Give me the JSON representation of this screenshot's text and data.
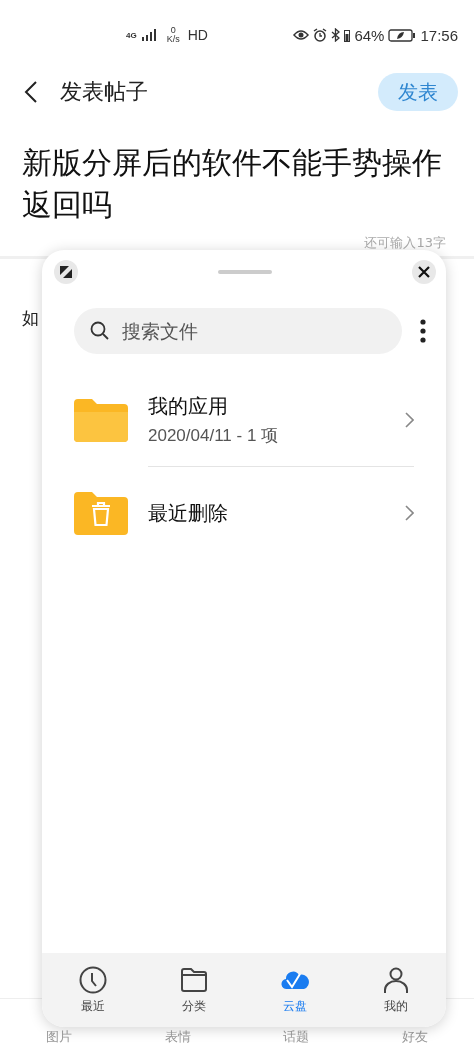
{
  "status_bar": {
    "network": "4G",
    "speed_value": "0",
    "speed_unit": "K/s",
    "hd": "HD",
    "battery_percent": "64%",
    "time": "17:56"
  },
  "header": {
    "title": "发表帖子",
    "publish_button": "发表",
    "publish_disabled": true
  },
  "post": {
    "title": "新版分屏后的软件不能手势操作返回吗",
    "counter": "还可输入13字",
    "body": "如"
  },
  "bottom_tabs": [
    {
      "label": "图片"
    },
    {
      "label": "表情"
    },
    {
      "label": "话题"
    },
    {
      "label": "好友"
    }
  ],
  "panel": {
    "search": {
      "placeholder": "搜索文件"
    },
    "items": [
      {
        "kind": "folder",
        "name": "我的应用",
        "meta": "2020/04/11 - 1 项"
      },
      {
        "kind": "trash",
        "name": "最近删除"
      }
    ],
    "nav": [
      {
        "kind": "recent",
        "label": "最近",
        "selected": false
      },
      {
        "kind": "category",
        "label": "分类",
        "selected": false
      },
      {
        "kind": "cloud",
        "label": "云盘",
        "selected": true
      },
      {
        "kind": "mine",
        "label": "我的",
        "selected": false
      }
    ]
  }
}
